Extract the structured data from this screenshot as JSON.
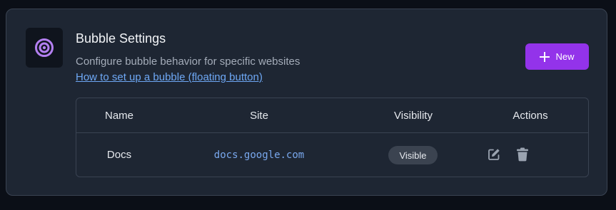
{
  "header": {
    "title": "Bubble Settings",
    "subtitle": "Configure bubble behavior for specific websites",
    "help_link": "How to set up a bubble (floating button)"
  },
  "toolbar": {
    "new_label": "New",
    "new_icon": "plus-icon"
  },
  "table": {
    "columns": [
      "Name",
      "Site",
      "Visibility",
      "Actions"
    ],
    "rows": [
      {
        "name": "Docs",
        "site": "docs.google.com",
        "visibility": "Visible",
        "actions": [
          "edit-icon",
          "trash-icon"
        ]
      }
    ]
  },
  "colors": {
    "accent": "#9333ea",
    "logo": "#b37ff0",
    "link": "#6ea8f5",
    "card_bg": "#1e2633"
  }
}
